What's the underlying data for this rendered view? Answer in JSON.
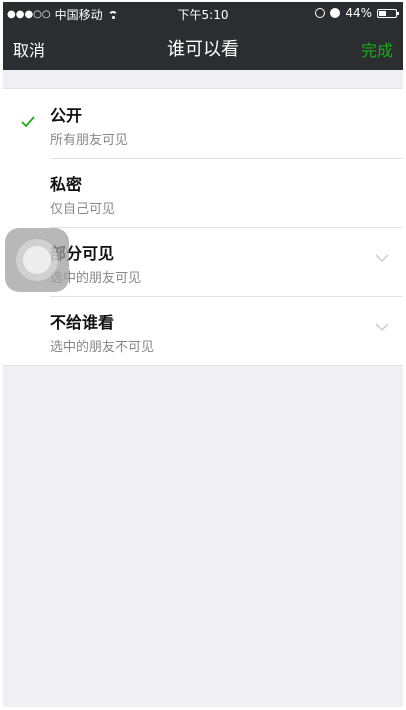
{
  "status_bar": {
    "signal_dots": "●●●○○",
    "carrier": "中国移动",
    "time": "下午5:10",
    "battery_text": "44%",
    "battery_level": 0.44
  },
  "nav": {
    "cancel_label": "取消",
    "title": "谁可以看",
    "done_label": "完成",
    "done_color": "#1aad19"
  },
  "options": [
    {
      "title": "公开",
      "subtitle": "所有朋友可见",
      "selected": true,
      "has_chevron": false
    },
    {
      "title": "私密",
      "subtitle": "仅自己可见",
      "selected": false,
      "has_chevron": false
    },
    {
      "title": "部分可见",
      "subtitle": "选中的朋友可见",
      "selected": false,
      "has_chevron": true
    },
    {
      "title": "不给谁看",
      "subtitle": "选中的朋友不可见",
      "selected": false,
      "has_chevron": true
    }
  ],
  "icons": {
    "check": "check-icon",
    "chevron": "chevron-down-icon",
    "wifi": "wifi-icon",
    "battery": "battery-icon"
  }
}
